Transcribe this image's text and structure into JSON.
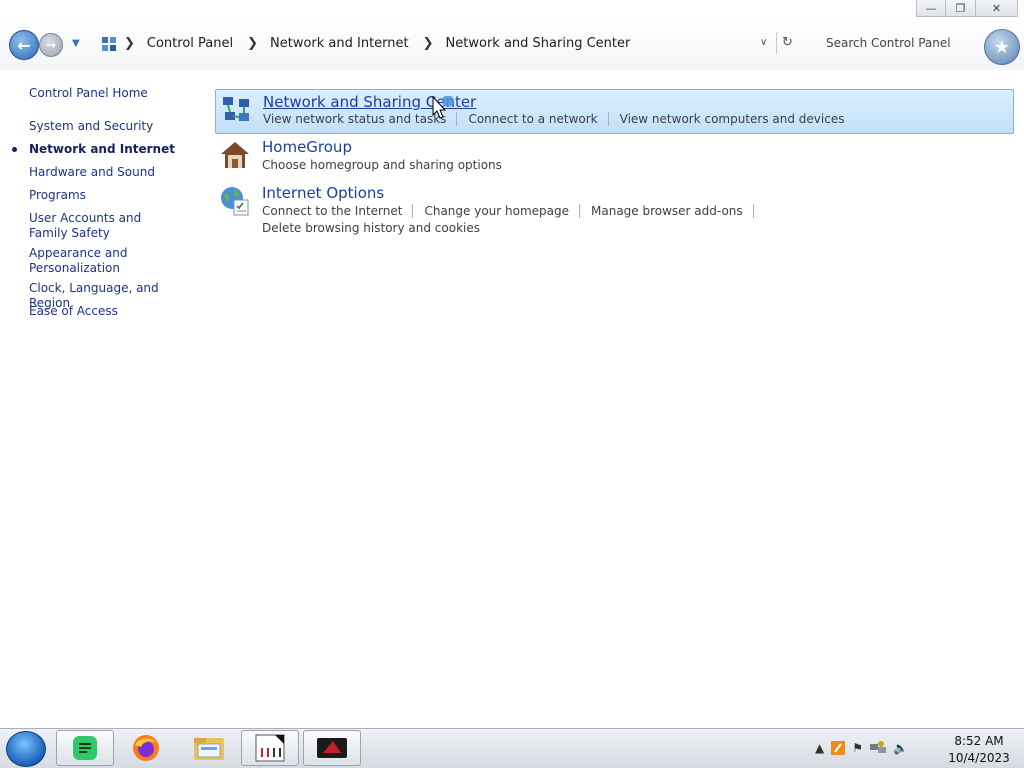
{
  "window": {
    "minimize_glyph": "—",
    "maximize_glyph": "❐",
    "close_glyph": "✕"
  },
  "address_bar": {
    "breadcrumbs": [
      "Control Panel",
      "Network and Internet",
      "Network and Sharing Center"
    ],
    "search_placeholder": "Search Control Panel"
  },
  "left_nav": {
    "items": [
      {
        "label": "Control Panel Home",
        "current": false
      },
      {
        "label": "System and Security",
        "current": false
      },
      {
        "label": "Network and Internet",
        "current": true
      },
      {
        "label": "Hardware and Sound",
        "current": false
      },
      {
        "label": "Programs",
        "current": false
      },
      {
        "label": "User Accounts and Family Safety",
        "current": false
      },
      {
        "label": "Appearance and Personalization",
        "current": false
      },
      {
        "label": "Clock, Language, and Region",
        "current": false
      },
      {
        "label": "Ease of Access",
        "current": false
      }
    ]
  },
  "categories": [
    {
      "title": "Network and Sharing Center",
      "icon": "network-icon",
      "highlighted": true,
      "links": [
        "View network status and tasks",
        "Connect to a network",
        "View network computers and devices"
      ]
    },
    {
      "title": "HomeGroup",
      "icon": "homegroup-icon",
      "highlighted": false,
      "links": [
        "Choose homegroup and sharing options"
      ]
    },
    {
      "title": "Internet Options",
      "icon": "internet-options-icon",
      "highlighted": false,
      "links": [
        "Connect to the Internet",
        "Change your homepage",
        "Manage browser add-ons"
      ],
      "links_row2": [
        "Delete browsing history and cookies"
      ]
    }
  ],
  "taskbar": {
    "apps": [
      "notes-app-icon",
      "firefox-icon",
      "file-explorer-icon",
      "document-app-icon",
      "media-app-icon"
    ],
    "tray_icons": [
      "show-hidden-icons-icon",
      "app-tray-icon",
      "flag-icon",
      "network-tray-icon",
      "volume-icon"
    ],
    "clock_time": "8:52 AM",
    "clock_date": "10/4/2023"
  },
  "colors": {
    "link_text": "#1a3ea1",
    "highlight_bg": "#c2e0f8",
    "highlight_border": "#7fb4e3",
    "nav_text": "#1e3287"
  }
}
